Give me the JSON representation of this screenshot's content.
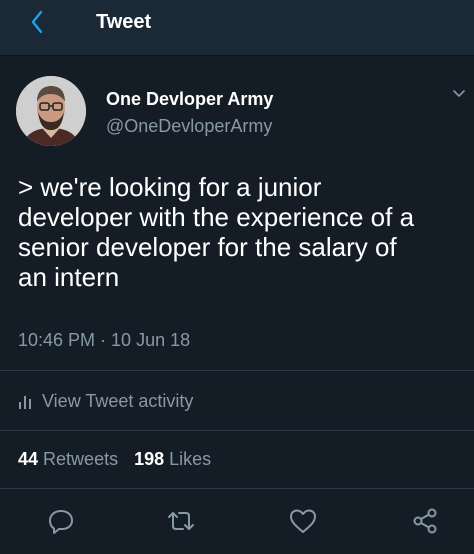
{
  "header": {
    "title": "Tweet"
  },
  "user": {
    "display_name": "One Devloper Army",
    "handle": "@OneDevloperArmy"
  },
  "tweet": {
    "lines": [
      "> we're looking for a junior",
      "developer with the experience of a",
      "senior developer for the salary of",
      "an intern"
    ],
    "timestamp": "10:46 PM · 10 Jun 18"
  },
  "activity": {
    "label": "View Tweet activity"
  },
  "stats": {
    "retweets_count": "44",
    "retweets_label": "Retweets",
    "likes_count": "198",
    "likes_label": "Likes"
  },
  "colors": {
    "background": "#141d26",
    "header": "#1b2836",
    "accent": "#1da1f2",
    "muted": "#8899a6"
  }
}
